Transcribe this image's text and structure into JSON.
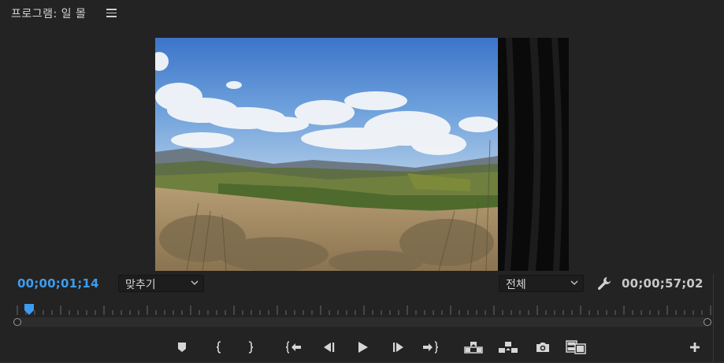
{
  "panel": {
    "title": "프로그램: 일 몰",
    "menu_icon": "hamburger-menu-icon"
  },
  "viewer": {
    "frame": "landscape-with-hills-and-clouds",
    "overlay": "dark-fabric-curtain-transition"
  },
  "timecode": {
    "current": "00;00;01;14",
    "duration": "00;00;57;02"
  },
  "zoom_select": {
    "value": "맞추기"
  },
  "resolution_select": {
    "value": "전체"
  },
  "playhead_position": 0.024,
  "controls": [
    {
      "name": "add-marker-button",
      "icon": "marker-icon"
    },
    {
      "name": "mark-in-button",
      "icon": "mark-in-icon"
    },
    {
      "name": "mark-out-button",
      "icon": "mark-out-icon"
    },
    {
      "name": "go-to-in-button",
      "icon": "go-to-in-icon"
    },
    {
      "name": "step-back-button",
      "icon": "step-back-icon"
    },
    {
      "name": "play-button",
      "icon": "play-icon"
    },
    {
      "name": "step-forward-button",
      "icon": "step-forward-icon"
    },
    {
      "name": "go-to-out-button",
      "icon": "go-to-out-icon"
    },
    {
      "name": "lift-button",
      "icon": "lift-icon"
    },
    {
      "name": "extract-button",
      "icon": "extract-icon"
    },
    {
      "name": "export-frame-button",
      "icon": "camera-icon"
    },
    {
      "name": "comparison-view-button",
      "icon": "comparison-view-icon"
    },
    {
      "name": "button-editor-button",
      "icon": "plus-icon"
    }
  ],
  "colors": {
    "background": "#232323",
    "accent": "#3d9cf0",
    "text": "#cfcfcf"
  }
}
